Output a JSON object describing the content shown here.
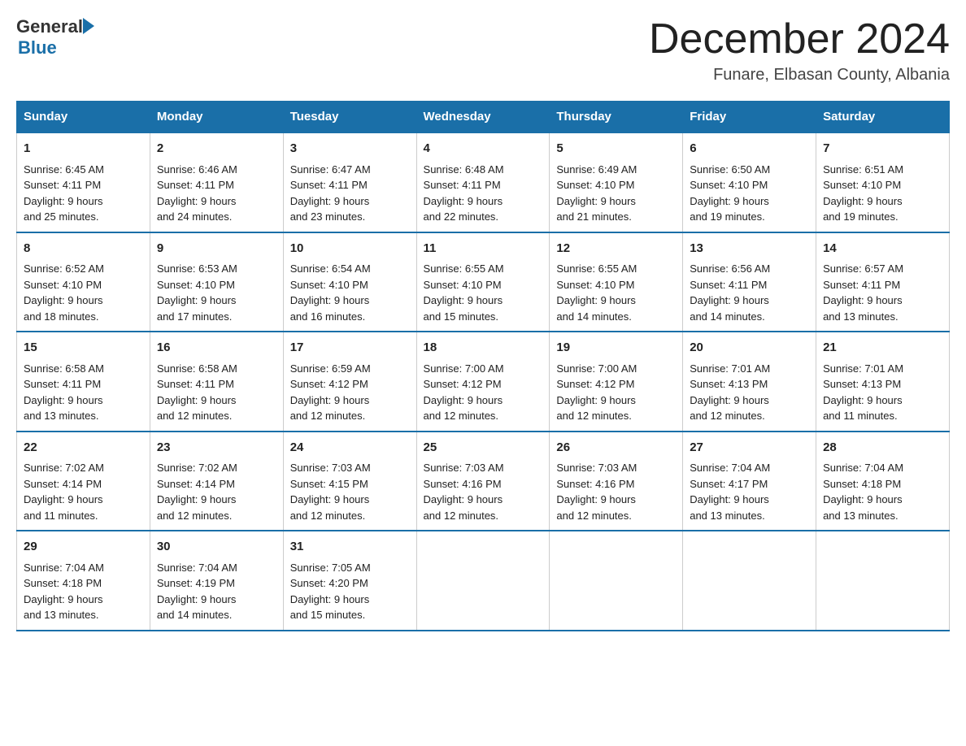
{
  "header": {
    "logo_general": "General",
    "logo_blue": "Blue",
    "month_title": "December 2024",
    "subtitle": "Funare, Elbasan County, Albania"
  },
  "days_of_week": [
    "Sunday",
    "Monday",
    "Tuesday",
    "Wednesday",
    "Thursday",
    "Friday",
    "Saturday"
  ],
  "weeks": [
    [
      {
        "day": "1",
        "sunrise": "6:45 AM",
        "sunset": "4:11 PM",
        "daylight": "9 hours and 25 minutes."
      },
      {
        "day": "2",
        "sunrise": "6:46 AM",
        "sunset": "4:11 PM",
        "daylight": "9 hours and 24 minutes."
      },
      {
        "day": "3",
        "sunrise": "6:47 AM",
        "sunset": "4:11 PM",
        "daylight": "9 hours and 23 minutes."
      },
      {
        "day": "4",
        "sunrise": "6:48 AM",
        "sunset": "4:11 PM",
        "daylight": "9 hours and 22 minutes."
      },
      {
        "day": "5",
        "sunrise": "6:49 AM",
        "sunset": "4:10 PM",
        "daylight": "9 hours and 21 minutes."
      },
      {
        "day": "6",
        "sunrise": "6:50 AM",
        "sunset": "4:10 PM",
        "daylight": "9 hours and 19 minutes."
      },
      {
        "day": "7",
        "sunrise": "6:51 AM",
        "sunset": "4:10 PM",
        "daylight": "9 hours and 19 minutes."
      }
    ],
    [
      {
        "day": "8",
        "sunrise": "6:52 AM",
        "sunset": "4:10 PM",
        "daylight": "9 hours and 18 minutes."
      },
      {
        "day": "9",
        "sunrise": "6:53 AM",
        "sunset": "4:10 PM",
        "daylight": "9 hours and 17 minutes."
      },
      {
        "day": "10",
        "sunrise": "6:54 AM",
        "sunset": "4:10 PM",
        "daylight": "9 hours and 16 minutes."
      },
      {
        "day": "11",
        "sunrise": "6:55 AM",
        "sunset": "4:10 PM",
        "daylight": "9 hours and 15 minutes."
      },
      {
        "day": "12",
        "sunrise": "6:55 AM",
        "sunset": "4:10 PM",
        "daylight": "9 hours and 14 minutes."
      },
      {
        "day": "13",
        "sunrise": "6:56 AM",
        "sunset": "4:11 PM",
        "daylight": "9 hours and 14 minutes."
      },
      {
        "day": "14",
        "sunrise": "6:57 AM",
        "sunset": "4:11 PM",
        "daylight": "9 hours and 13 minutes."
      }
    ],
    [
      {
        "day": "15",
        "sunrise": "6:58 AM",
        "sunset": "4:11 PM",
        "daylight": "9 hours and 13 minutes."
      },
      {
        "day": "16",
        "sunrise": "6:58 AM",
        "sunset": "4:11 PM",
        "daylight": "9 hours and 12 minutes."
      },
      {
        "day": "17",
        "sunrise": "6:59 AM",
        "sunset": "4:12 PM",
        "daylight": "9 hours and 12 minutes."
      },
      {
        "day": "18",
        "sunrise": "7:00 AM",
        "sunset": "4:12 PM",
        "daylight": "9 hours and 12 minutes."
      },
      {
        "day": "19",
        "sunrise": "7:00 AM",
        "sunset": "4:12 PM",
        "daylight": "9 hours and 12 minutes."
      },
      {
        "day": "20",
        "sunrise": "7:01 AM",
        "sunset": "4:13 PM",
        "daylight": "9 hours and 12 minutes."
      },
      {
        "day": "21",
        "sunrise": "7:01 AM",
        "sunset": "4:13 PM",
        "daylight": "9 hours and 11 minutes."
      }
    ],
    [
      {
        "day": "22",
        "sunrise": "7:02 AM",
        "sunset": "4:14 PM",
        "daylight": "9 hours and 11 minutes."
      },
      {
        "day": "23",
        "sunrise": "7:02 AM",
        "sunset": "4:14 PM",
        "daylight": "9 hours and 12 minutes."
      },
      {
        "day": "24",
        "sunrise": "7:03 AM",
        "sunset": "4:15 PM",
        "daylight": "9 hours and 12 minutes."
      },
      {
        "day": "25",
        "sunrise": "7:03 AM",
        "sunset": "4:16 PM",
        "daylight": "9 hours and 12 minutes."
      },
      {
        "day": "26",
        "sunrise": "7:03 AM",
        "sunset": "4:16 PM",
        "daylight": "9 hours and 12 minutes."
      },
      {
        "day": "27",
        "sunrise": "7:04 AM",
        "sunset": "4:17 PM",
        "daylight": "9 hours and 13 minutes."
      },
      {
        "day": "28",
        "sunrise": "7:04 AM",
        "sunset": "4:18 PM",
        "daylight": "9 hours and 13 minutes."
      }
    ],
    [
      {
        "day": "29",
        "sunrise": "7:04 AM",
        "sunset": "4:18 PM",
        "daylight": "9 hours and 13 minutes."
      },
      {
        "day": "30",
        "sunrise": "7:04 AM",
        "sunset": "4:19 PM",
        "daylight": "9 hours and 14 minutes."
      },
      {
        "day": "31",
        "sunrise": "7:05 AM",
        "sunset": "4:20 PM",
        "daylight": "9 hours and 15 minutes."
      },
      null,
      null,
      null,
      null
    ]
  ],
  "labels": {
    "sunrise": "Sunrise:",
    "sunset": "Sunset:",
    "daylight": "Daylight:"
  }
}
